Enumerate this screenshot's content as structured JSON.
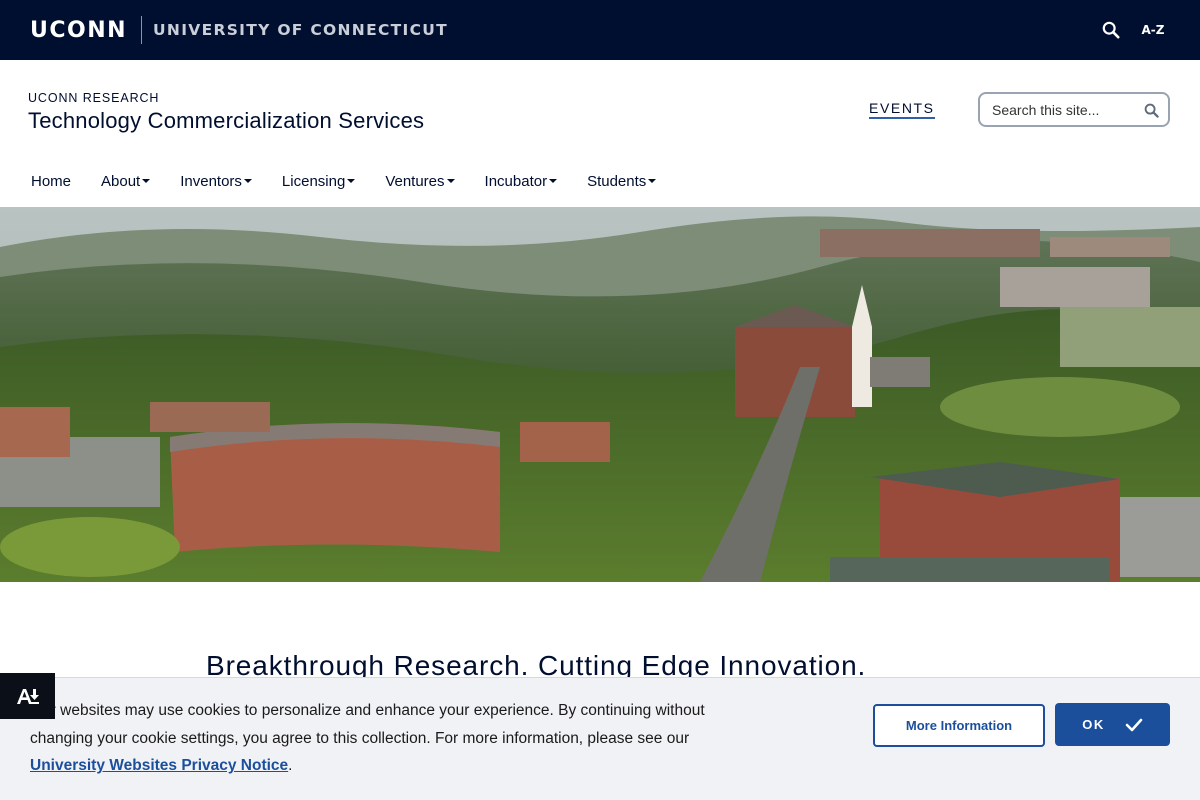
{
  "topbar": {
    "brand": "UCONN",
    "university": "UNIVERSITY OF CONNECTICUT",
    "search_icon": "search-icon",
    "az_label": "A-Z"
  },
  "site": {
    "parent": "UCONN RESEARCH",
    "title": "Technology Commercialization Services",
    "events_label": "EVENTS",
    "search_placeholder": "Search this site...",
    "search_icon": "search-icon"
  },
  "nav": {
    "items": [
      {
        "label": "Home",
        "dropdown": false
      },
      {
        "label": "About",
        "dropdown": true
      },
      {
        "label": "Inventors",
        "dropdown": true
      },
      {
        "label": "Licensing",
        "dropdown": true
      },
      {
        "label": "Ventures",
        "dropdown": true
      },
      {
        "label": "Incubator",
        "dropdown": true
      },
      {
        "label": "Students",
        "dropdown": true
      }
    ]
  },
  "hero": {
    "description_icon": "campus-aerial-photo"
  },
  "main": {
    "heading": "Breakthrough Research. Cutting Edge Innovation."
  },
  "cookie": {
    "text_before": "Our websites may use cookies to personalize and enhance your experience. By continuing without changing your cookie settings, you agree to this collection. For more information, please see our ",
    "link_text": "University Websites Privacy Notice",
    "text_after": ".",
    "more_info_label": "More Information",
    "ok_label": "OK",
    "ok_icon": "checkmark-icon"
  },
  "accessibility": {
    "icon": "accessibility-download-icon"
  },
  "colors": {
    "navy": "#000e2f",
    "link_blue": "#1b4f9c",
    "banner_bg": "#f1f2f5"
  }
}
